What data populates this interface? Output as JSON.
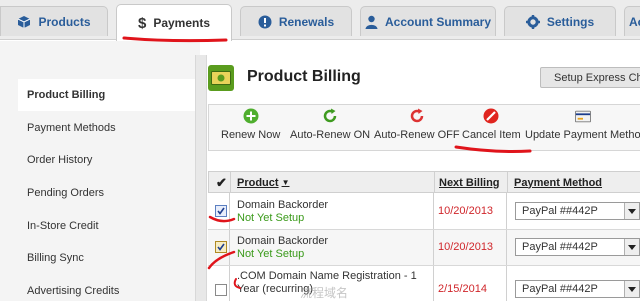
{
  "tabs": [
    {
      "label": "Products",
      "icon": "cube-icon"
    },
    {
      "label": "Payments",
      "icon": "dollar-icon"
    },
    {
      "label": "Renewals",
      "icon": "info-icon"
    },
    {
      "label": "Account Summary",
      "icon": "user-icon"
    },
    {
      "label": "Settings",
      "icon": "gear-icon"
    },
    {
      "label": "Ac",
      "icon": ""
    }
  ],
  "tab_dollar": "$",
  "sidebar": {
    "items": [
      {
        "label": "Product Billing"
      },
      {
        "label": "Payment Methods"
      },
      {
        "label": "Order History"
      },
      {
        "label": "Pending Orders"
      },
      {
        "label": "In-Store Credit"
      },
      {
        "label": "Billing Sync"
      },
      {
        "label": "Advertising Credits"
      }
    ]
  },
  "page": {
    "title": "Product Billing",
    "express_button": "Setup Express Ch"
  },
  "toolbar": {
    "renew_now": "Renew Now",
    "auto_on": "Auto-Renew ON",
    "auto_off": "Auto-Renew OFF",
    "cancel": "Cancel Item",
    "update_payment": "Update Payment Metho"
  },
  "table": {
    "headers": {
      "product": "Product",
      "next_billing": "Next Billing",
      "payment_method": "Payment Method"
    },
    "rows": [
      {
        "product": "Domain Backorder",
        "status": "Not Yet Setup",
        "date": "10/20/2013",
        "payment": "PayPal ##442P",
        "checked": true
      },
      {
        "product": "Domain Backorder",
        "status": "Not Yet Setup",
        "date": "10/20/2013",
        "payment": "PayPal ##442P",
        "checked": true
      },
      {
        "product": ".COM Domain Name Registration - 1",
        "product_line2": "Year (recurring)",
        "status": "",
        "date": "2/15/2014",
        "payment": "PayPal ##442P",
        "checked": false
      }
    ]
  },
  "watermark": "流程域名",
  "colors": {
    "link_blue": "#2a5d9a",
    "status_green": "#3a9a1a",
    "date_red": "#d0262b",
    "annotation_red": "#e0141b",
    "icon_green": "#5a9c1e"
  }
}
